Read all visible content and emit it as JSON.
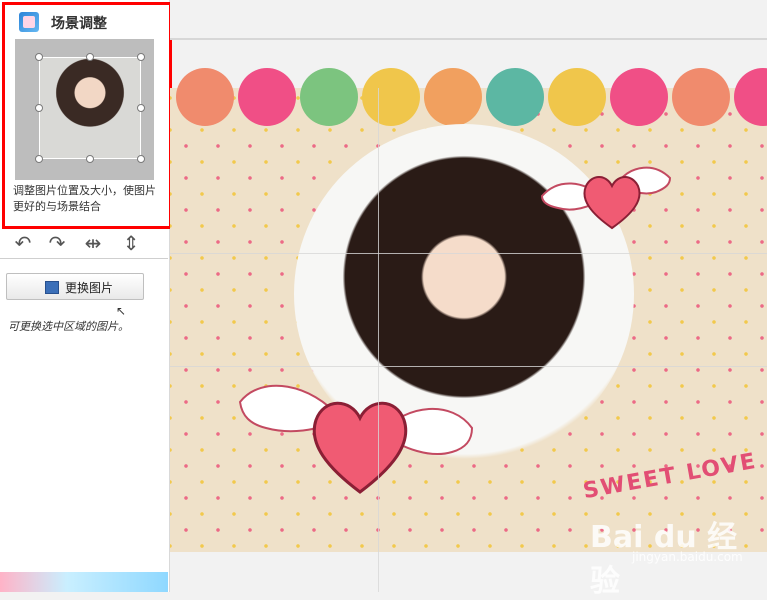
{
  "left_panel": {
    "title": "场景调整",
    "hint": "调整图片位置及大小，使图片更好的与场景结合",
    "change_button_label": "更换图片",
    "note": "可更换选中区域的图片。",
    "tools": [
      {
        "name": "rotate-left-icon",
        "glyph": "↶"
      },
      {
        "name": "rotate-right-icon",
        "glyph": "↷"
      },
      {
        "name": "flip-horizontal-icon",
        "glyph": "⇹"
      },
      {
        "name": "flip-vertical-icon",
        "glyph": "⇕"
      }
    ]
  },
  "scene": {
    "caption": "SWEET LOVE",
    "watermark": "Bai du 经验",
    "watermark_url": "jingyan.baidu.com",
    "scallop_colors": [
      "#f08b6d",
      "#f04f86",
      "#7cc47f",
      "#f0c64b",
      "#f1a05f",
      "#5cb7a3",
      "#f0c64b",
      "#f04f86"
    ]
  },
  "colors": {
    "highlight": "#ff0000",
    "canvas_bg": "#efe1c9",
    "caption": "#e24e74"
  }
}
